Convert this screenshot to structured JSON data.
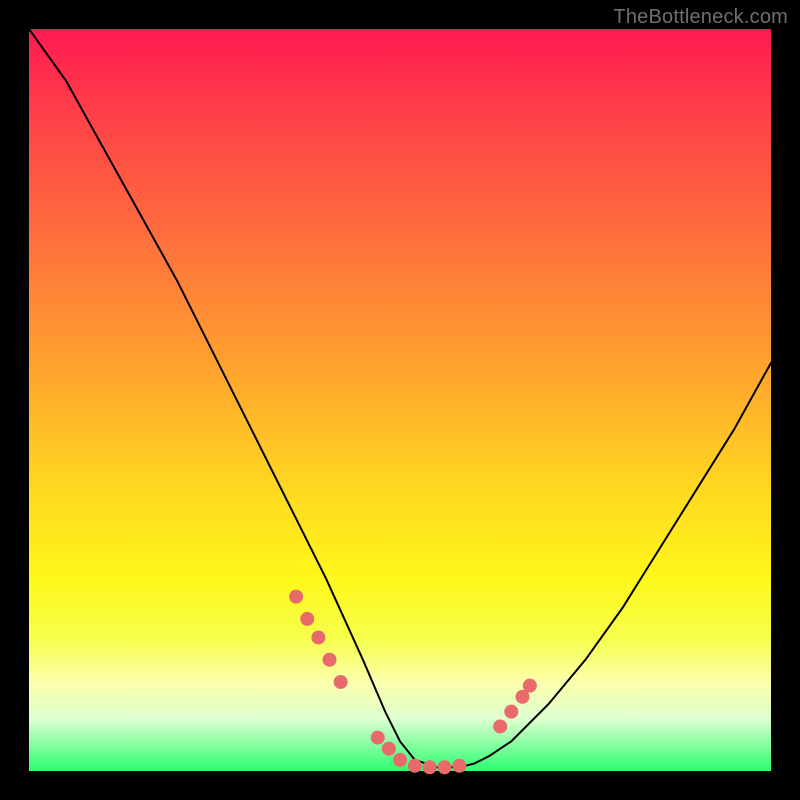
{
  "watermark": "TheBottleneck.com",
  "chart_data": {
    "type": "line",
    "title": "",
    "xlabel": "",
    "ylabel": "",
    "xlim": [
      0,
      100
    ],
    "ylim": [
      0,
      100
    ],
    "series": [
      {
        "name": "bottleneck-curve",
        "x": [
          0,
          5,
          10,
          15,
          20,
          25,
          30,
          35,
          40,
          45,
          48,
          50,
          52,
          55,
          58,
          60,
          62,
          65,
          70,
          75,
          80,
          85,
          90,
          95,
          100
        ],
        "values": [
          100,
          93,
          84,
          75,
          66,
          56,
          46,
          36,
          26,
          15,
          8,
          4,
          1.5,
          0.5,
          0.5,
          1,
          2,
          4,
          9,
          15,
          22,
          30,
          38,
          46,
          55
        ]
      }
    ],
    "markers": {
      "name": "highlight-dots",
      "color": "#e96a6a",
      "radius_px": 7,
      "x": [
        36,
        37.5,
        39,
        40.5,
        42,
        47,
        48.5,
        50,
        52,
        54,
        56,
        58,
        63.5,
        65,
        66.5,
        67.5
      ],
      "values": [
        23.5,
        20.5,
        18,
        15,
        12,
        4.5,
        3,
        1.5,
        0.7,
        0.5,
        0.5,
        0.7,
        6,
        8,
        10,
        11.5
      ]
    }
  }
}
